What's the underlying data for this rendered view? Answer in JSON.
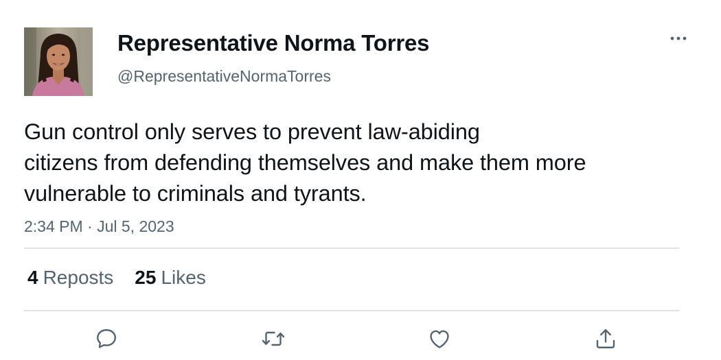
{
  "author": {
    "display_name": "Representative Norma Torres",
    "handle": "@RepresentativeNormaTorres",
    "avatar_icon": "profile-photo"
  },
  "tweet": {
    "text": "Gun control only serves to prevent law-abiding\ncitizens from defending themselves and make them more\nvulnerable to criminals and tyrants.",
    "timestamp": "2:34 PM · Jul 5, 2023"
  },
  "stats": {
    "reposts_count": "4",
    "reposts_label": "Reposts",
    "likes_count": "25",
    "likes_label": "Likes"
  },
  "actions": [
    {
      "name": "reply",
      "icon": "speech-bubble-icon"
    },
    {
      "name": "repost",
      "icon": "repost-arrows-icon"
    },
    {
      "name": "like",
      "icon": "heart-icon"
    },
    {
      "name": "share",
      "icon": "share-upload-icon"
    }
  ],
  "colors": {
    "text_primary": "#0f1419",
    "text_secondary": "#536471",
    "divider": "#dfe3e6",
    "icon": "#536471"
  }
}
